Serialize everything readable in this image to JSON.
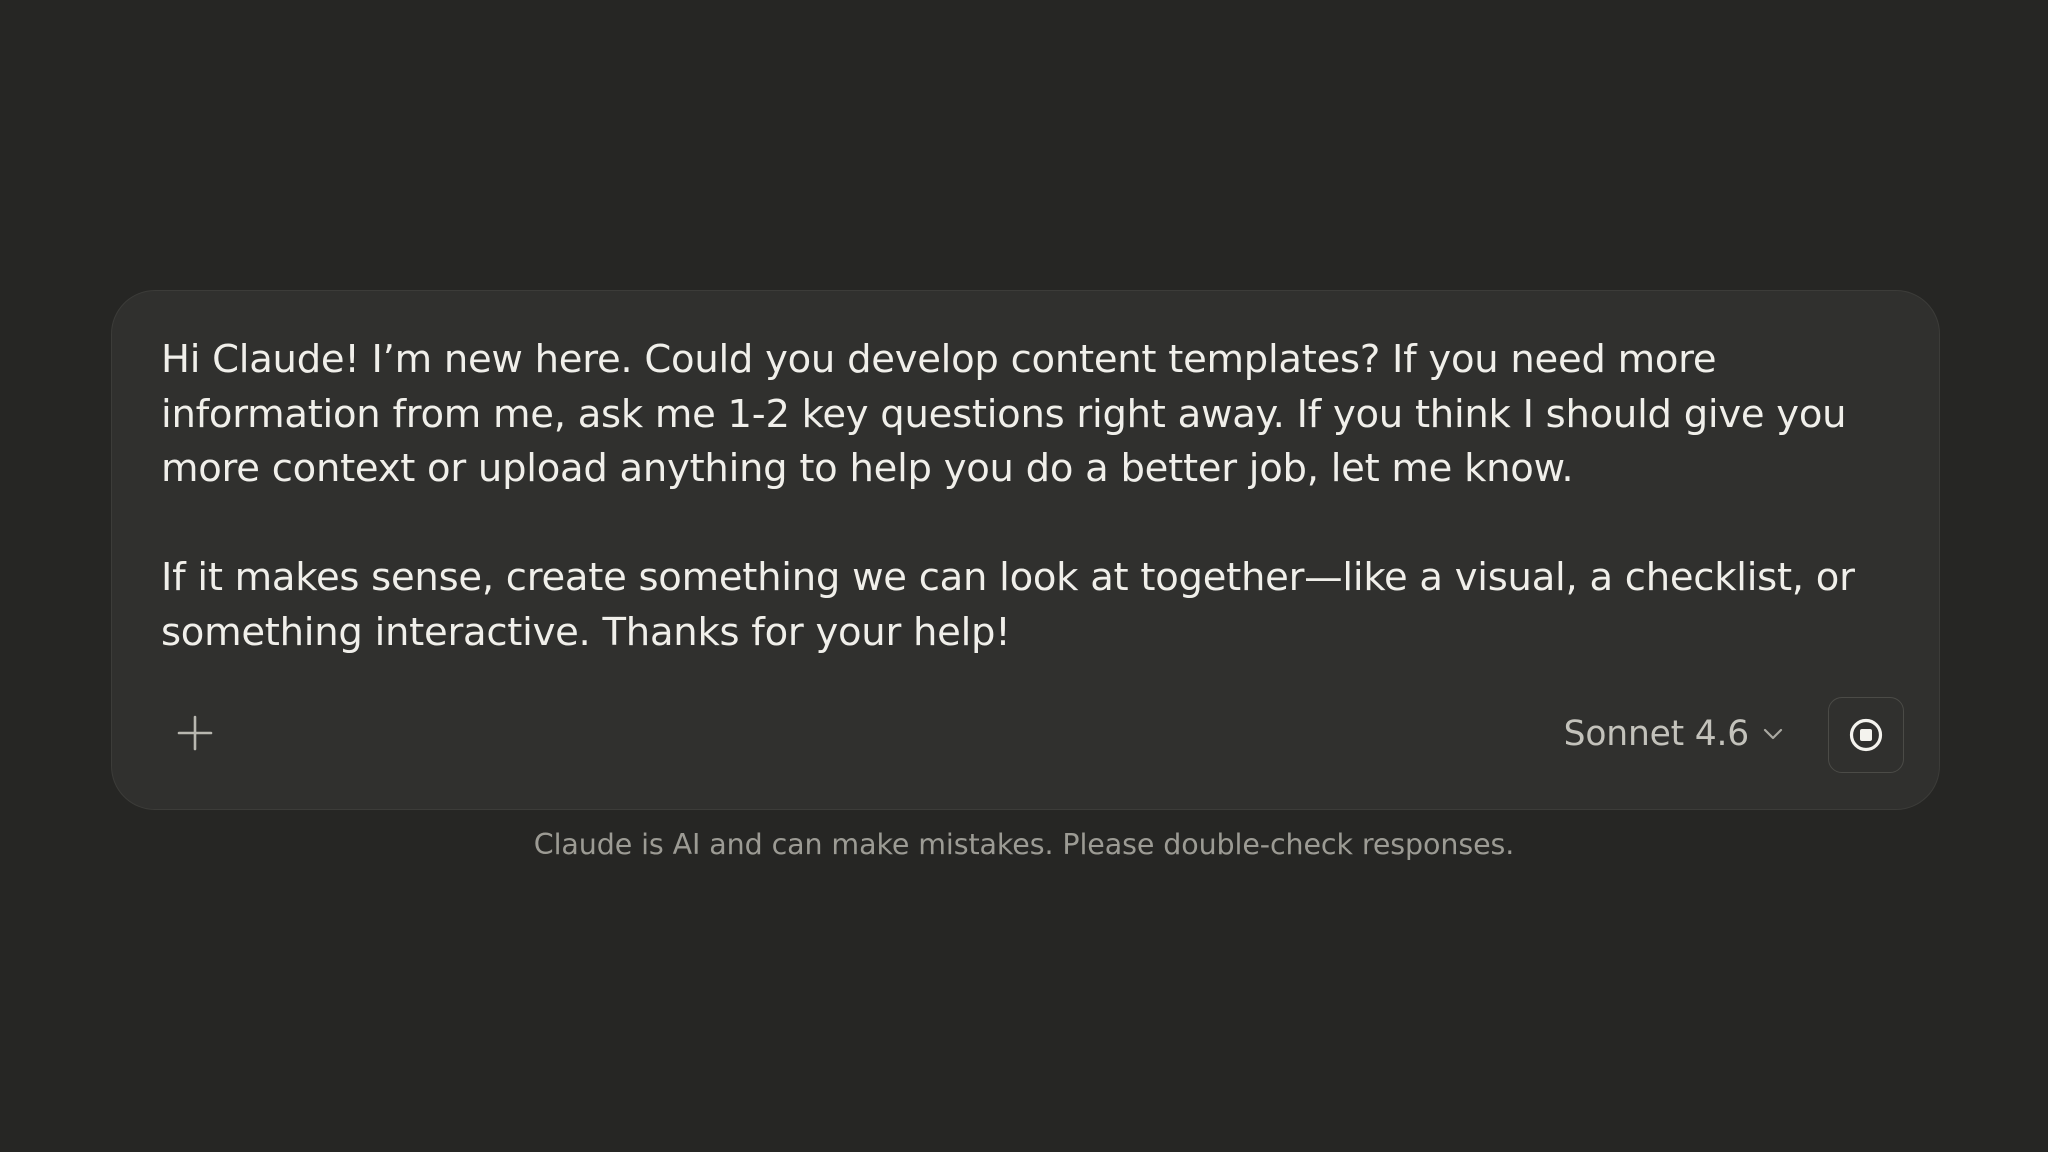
{
  "composer": {
    "message_paragraphs": [
      "Hi Claude! I’m new here. Could you develop content templates? If you need more information from me, ask me 1-2 key questions right away. If you think I should give you more context or upload anything to help you do a better job, let me know.",
      "If it makes sense, create something we can look at together—like a visual, a checklist, or something interactive. Thanks for your help!"
    ],
    "add_icon": "plus-icon",
    "model_label": "Sonnet 4.6",
    "model_dropdown_icon": "chevron-down-icon",
    "record_icon": "stop-record-icon"
  },
  "footer": {
    "disclaimer": "Claude is AI and can make mistakes. Please double-check responses."
  },
  "colors": {
    "page_background": "#262624",
    "composer_background": "#30302e",
    "primary_text": "#f0efea",
    "secondary_text": "#c3c2bb",
    "muted_text": "#9c9b94"
  }
}
